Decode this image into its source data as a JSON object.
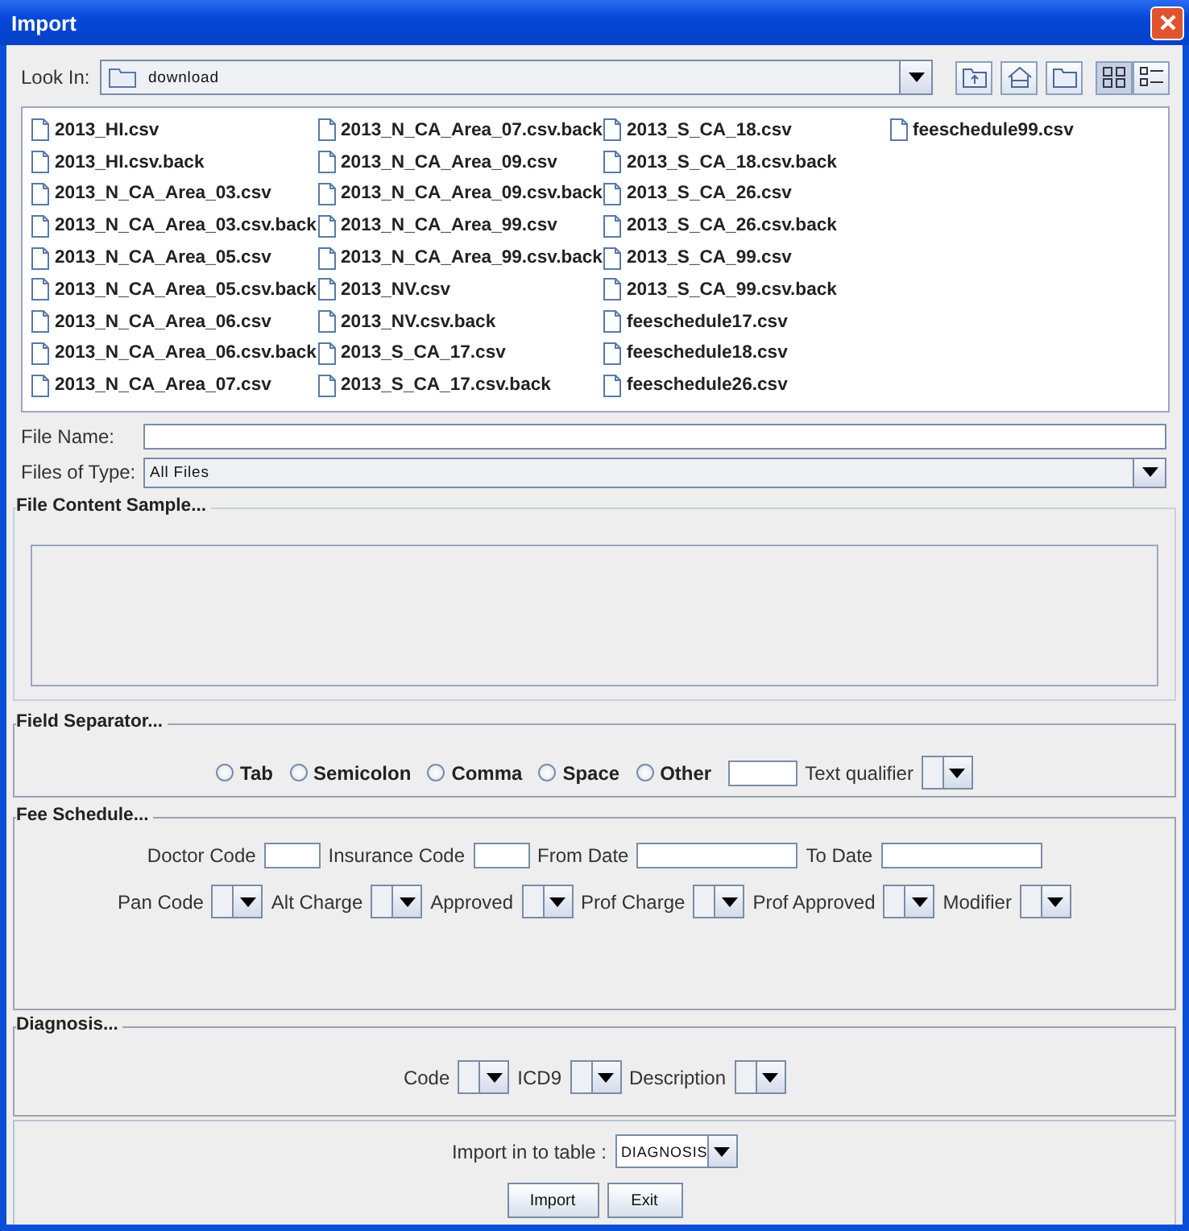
{
  "window": {
    "title": "Import"
  },
  "look_in": {
    "label": "Look In:",
    "value": "download"
  },
  "view_buttons": [
    {
      "kind": "list",
      "selected": true
    },
    {
      "kind": "details",
      "selected": false
    }
  ],
  "files": [
    "2013_HI.csv",
    "2013_HI.csv.back",
    "2013_N_CA_Area_03.csv",
    "2013_N_CA_Area_03.csv.back",
    "2013_N_CA_Area_05.csv",
    "2013_N_CA_Area_05.csv.back",
    "2013_N_CA_Area_06.csv",
    "2013_N_CA_Area_06.csv.back",
    "2013_N_CA_Area_07.csv",
    "2013_N_CA_Area_07.csv.back",
    "2013_N_CA_Area_09.csv",
    "2013_N_CA_Area_09.csv.back",
    "2013_N_CA_Area_99.csv",
    "2013_N_CA_Area_99.csv.back",
    "2013_NV.csv",
    "2013_NV.csv.back",
    "2013_S_CA_17.csv",
    "2013_S_CA_17.csv.back",
    "2013_S_CA_18.csv",
    "2013_S_CA_18.csv.back",
    "2013_S_CA_26.csv",
    "2013_S_CA_26.csv.back",
    "2013_S_CA_99.csv",
    "2013_S_CA_99.csv.back",
    "feeschedule17.csv",
    "feeschedule18.csv",
    "feeschedule26.csv",
    "feeschedule99.csv"
  ],
  "file_name": {
    "label": "File Name:"
  },
  "files_of_type": {
    "label": "Files of Type:",
    "value": "All Files"
  },
  "content_sample": {
    "title": "File Content Sample..."
  },
  "field_separator": {
    "title": "Field Separator...",
    "options": [
      {
        "label": "Tab",
        "selected": false
      },
      {
        "label": "Semicolon",
        "selected": false
      },
      {
        "label": "Comma",
        "selected": false
      },
      {
        "label": "Space",
        "selected": false
      },
      {
        "label": "Other",
        "selected": false
      }
    ],
    "text_qualifier_label": "Text qualifier"
  },
  "fee_schedule": {
    "title": "Fee Schedule...",
    "fields": [
      {
        "label": "Doctor Code",
        "kind": "short"
      },
      {
        "label": "Insurance Code",
        "kind": "short"
      },
      {
        "label": "From Date",
        "kind": "long"
      },
      {
        "label": "To Date",
        "kind": "long"
      }
    ],
    "dropdowns": [
      "Pan Code",
      "Alt Charge",
      "Approved",
      "Prof Charge",
      "Prof Approved",
      "Modifier"
    ]
  },
  "diagnosis": {
    "title": "Diagnosis...",
    "dropdowns": [
      "Code",
      "ICD9",
      "Description"
    ]
  },
  "import_table": {
    "label": "Import in to table :",
    "value": "DIAGNOSIS"
  },
  "buttons": [
    "Import",
    "Exit"
  ]
}
